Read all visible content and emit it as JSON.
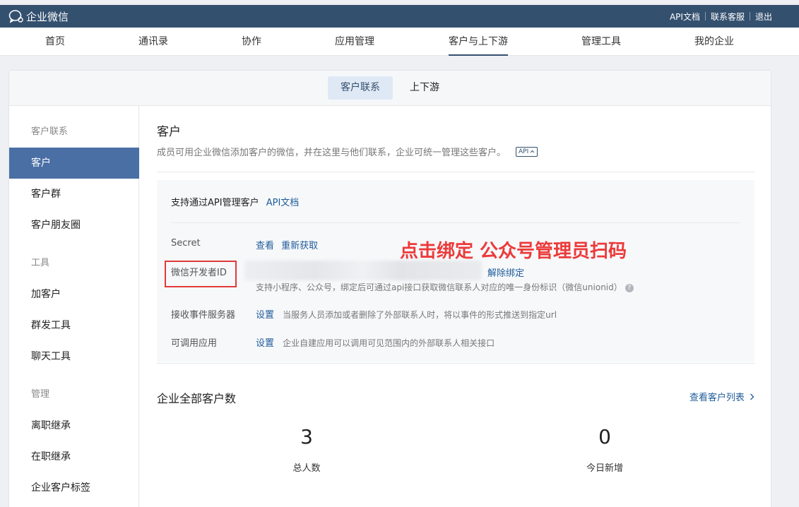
{
  "header": {
    "app_name": "企业微信",
    "links": [
      "API文档",
      "联系客服",
      "退出"
    ]
  },
  "nav": [
    "首页",
    "通讯录",
    "协作",
    "应用管理",
    "客户与上下游",
    "管理工具",
    "我的企业"
  ],
  "subtabs": [
    "客户联系",
    "上下游"
  ],
  "sidebar": {
    "groups": [
      "客户联系",
      "工具",
      "管理"
    ],
    "items": [
      "客户",
      "客户群",
      "客户朋友圈",
      "加客户",
      "群发工具",
      "聊天工具",
      "离职继承",
      "在职继承",
      "企业客户标签"
    ]
  },
  "main": {
    "title": "客户",
    "description": "成员可用企业微信添加客户的微信，并在这里与他们联系，企业可统一管理这些客户。",
    "api_tag": "API"
  },
  "api_box": {
    "support_text": "支持通过API管理客户",
    "api_doc_link": "API文档",
    "secret_label": "Secret",
    "secret_view": "查看",
    "secret_refresh": "重新获取",
    "devid_label": "微信开发者ID",
    "unbind": "解除绑定",
    "devid_hint": "支持小程序、公众号，绑定后可通过api接口获取微信联系人对应的唯一身份标识（微信unionid）",
    "event_label": "接收事件服务器",
    "event_action": "设置",
    "event_hint": "当服务人员添加或者删除了外部联系人时，将以事件的形式推送到指定url",
    "callable_label": "可调用应用",
    "callable_action": "设置",
    "callable_hint": "企业自建应用可以调用可见范围内的外部联系人相关接口",
    "annotation": "点击绑定 公众号管理员扫码"
  },
  "stats": {
    "title": "企业全部客户数",
    "view_list": "查看客户列表",
    "total": "3",
    "total_label": "总人数",
    "today": "0",
    "today_label": "今日新增"
  },
  "colors": {
    "header_bg": "#34506f",
    "sidebar_active": "#4a6fa5",
    "link": "#1f5c9a",
    "annotation": "#ec3a3a"
  }
}
